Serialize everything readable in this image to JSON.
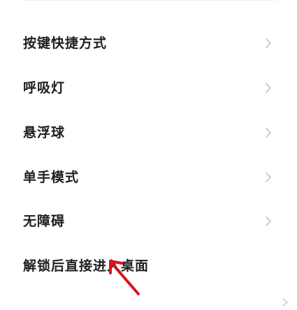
{
  "settings_list": {
    "items": [
      {
        "label": "按键快捷方式"
      },
      {
        "label": "呼吸灯"
      },
      {
        "label": "悬浮球"
      },
      {
        "label": "单手模式"
      },
      {
        "label": "无障碍"
      },
      {
        "label": "解锁后直接进入桌面"
      }
    ]
  },
  "icons": {
    "chevron": "chevron-right-icon",
    "annotation": "annotation-arrow-icon"
  },
  "colors": {
    "chevron": "#c4c4c4",
    "annotation_arrow": "#d9141a",
    "text": "#1f1f1f"
  }
}
